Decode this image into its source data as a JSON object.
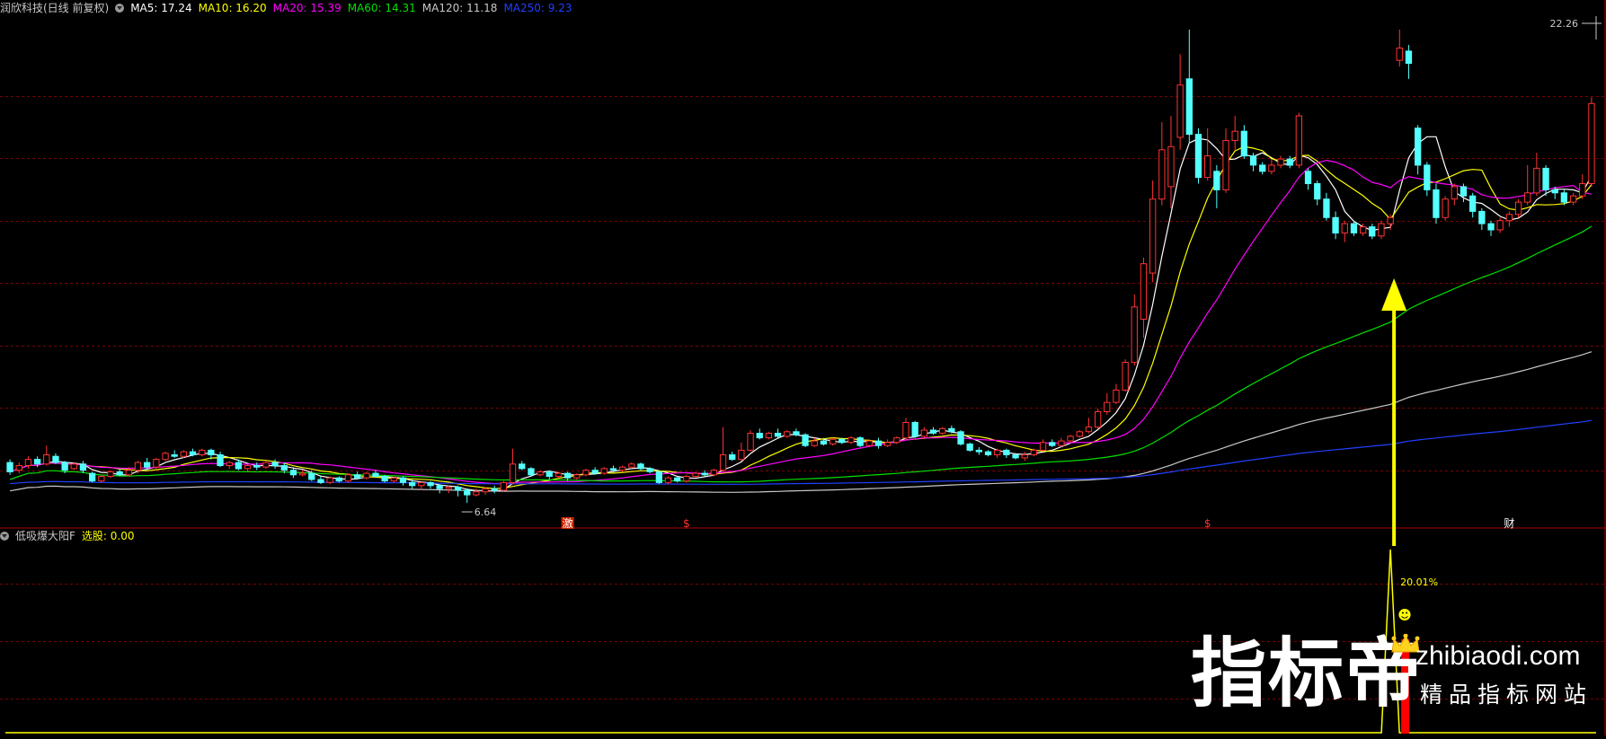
{
  "main_header": {
    "title": "润欣科技(日线 前复权)",
    "ma": [
      {
        "label": "MA5: 17.24",
        "color": "#ffffff"
      },
      {
        "label": "MA10: 16.20",
        "color": "#ffff00"
      },
      {
        "label": "MA20: 15.39",
        "color": "#ff00ff"
      },
      {
        "label": "MA60: 14.31",
        "color": "#00e000"
      },
      {
        "label": "MA120: 11.18",
        "color": "#c8c8c8"
      },
      {
        "label": "MA250: 9.23",
        "color": "#2040ff"
      }
    ]
  },
  "sub_header": {
    "indicator": "低吸爆大阳F",
    "select_label": "选股: 0.00"
  },
  "price_high_label": "22.26",
  "price_low_label": "6.64",
  "event_markers": [
    {
      "text": "激",
      "color": "#ffffff",
      "bg": "#cc2200",
      "index": 61
    },
    {
      "text": "$",
      "color": "#ff3030",
      "bg": "",
      "index": 74
    },
    {
      "text": "$",
      "color": "#ff3030",
      "bg": "",
      "index": 131
    },
    {
      "text": "财",
      "color": "#ffffff",
      "bg": "",
      "index": 164
    }
  ],
  "signal_label": "20.01%",
  "signal_emoji": "☻",
  "logo": {
    "big": "指标帝",
    "domain": "zhibiaodi.com",
    "slogan": "精品指标网站"
  },
  "colors": {
    "up": "#ff3232",
    "down": "#54ffff",
    "arrow": "#ffff00",
    "grid": "#7a0000"
  },
  "chart_data": [
    {
      "type": "candlestick",
      "title": "润欣科技(日线 前复权)",
      "ylim": [
        6.0,
        22.26
      ],
      "axis_labels": [
        "22.26"
      ],
      "candles": [
        [
          7.95,
          7.65,
          8.05,
          7.55
        ],
        [
          7.7,
          7.85,
          7.95,
          7.6
        ],
        [
          7.85,
          8.05,
          8.15,
          7.75
        ],
        [
          8.05,
          7.9,
          8.15,
          7.8
        ],
        [
          7.9,
          8.2,
          8.5,
          7.85
        ],
        [
          8.15,
          7.95,
          8.25,
          7.9
        ],
        [
          7.95,
          7.7,
          8.0,
          7.6
        ],
        [
          7.75,
          7.9,
          7.95,
          7.7
        ],
        [
          7.9,
          7.7,
          8.0,
          7.6
        ],
        [
          7.6,
          7.35,
          7.65,
          7.3
        ],
        [
          7.35,
          7.5,
          7.55,
          7.3
        ],
        [
          7.5,
          7.65,
          7.7,
          7.45
        ],
        [
          7.65,
          7.55,
          7.75,
          7.5
        ],
        [
          7.55,
          7.7,
          7.8,
          7.5
        ],
        [
          7.7,
          7.95,
          8.0,
          7.6
        ],
        [
          7.95,
          7.8,
          8.1,
          7.7
        ],
        [
          7.8,
          8.05,
          8.1,
          7.75
        ],
        [
          8.05,
          8.25,
          8.3,
          8.0
        ],
        [
          8.2,
          8.15,
          8.35,
          8.1
        ],
        [
          8.15,
          8.3,
          8.35,
          8.1
        ],
        [
          8.3,
          8.2,
          8.4,
          8.15
        ],
        [
          8.2,
          8.35,
          8.4,
          8.15
        ],
        [
          8.35,
          8.2,
          8.4,
          8.05
        ],
        [
          8.2,
          7.85,
          8.3,
          7.8
        ],
        [
          7.85,
          7.95,
          8.0,
          7.75
        ],
        [
          7.95,
          7.75,
          8.05,
          7.7
        ],
        [
          7.75,
          7.85,
          7.9,
          7.65
        ],
        [
          7.85,
          7.8,
          7.95,
          7.7
        ],
        [
          7.8,
          7.95,
          8.0,
          7.75
        ],
        [
          7.95,
          7.85,
          8.05,
          7.75
        ],
        [
          7.85,
          7.7,
          7.95,
          7.6
        ],
        [
          7.7,
          7.55,
          7.8,
          7.45
        ],
        [
          7.55,
          7.6,
          7.7,
          7.5
        ],
        [
          7.6,
          7.4,
          7.7,
          7.35
        ],
        [
          7.4,
          7.3,
          7.5,
          7.25
        ],
        [
          7.3,
          7.45,
          7.5,
          7.25
        ],
        [
          7.45,
          7.35,
          7.5,
          7.3
        ],
        [
          7.35,
          7.55,
          7.6,
          7.3
        ],
        [
          7.55,
          7.45,
          7.65,
          7.4
        ],
        [
          7.45,
          7.6,
          7.65,
          7.4
        ],
        [
          7.6,
          7.5,
          7.7,
          7.45
        ],
        [
          7.5,
          7.35,
          7.55,
          7.3
        ],
        [
          7.35,
          7.45,
          7.5,
          7.3
        ],
        [
          7.45,
          7.3,
          7.5,
          7.2
        ],
        [
          7.3,
          7.2,
          7.4,
          7.1
        ],
        [
          7.2,
          7.3,
          7.35,
          7.05
        ],
        [
          7.3,
          7.2,
          7.35,
          7.1
        ],
        [
          7.2,
          7.1,
          7.25,
          6.95
        ],
        [
          7.1,
          7.15,
          7.2,
          6.95
        ],
        [
          7.15,
          7.05,
          7.2,
          6.85
        ],
        [
          7.05,
          6.9,
          7.1,
          6.64
        ],
        [
          6.9,
          7.0,
          7.1,
          6.85
        ],
        [
          7.0,
          7.1,
          7.15,
          6.9
        ],
        [
          7.1,
          7.05,
          7.2,
          6.95
        ],
        [
          7.05,
          7.3,
          7.35,
          7.0
        ],
        [
          7.3,
          7.9,
          8.4,
          7.25
        ],
        [
          7.9,
          7.75,
          8.0,
          7.7
        ],
        [
          7.75,
          7.55,
          7.8,
          7.5
        ],
        [
          7.55,
          7.65,
          7.7,
          7.5
        ],
        [
          7.65,
          7.5,
          7.7,
          7.4
        ],
        [
          7.5,
          7.6,
          7.65,
          7.45
        ],
        [
          7.6,
          7.45,
          7.65,
          7.35
        ],
        [
          7.45,
          7.55,
          7.6,
          7.4
        ],
        [
          7.55,
          7.7,
          7.75,
          7.5
        ],
        [
          7.7,
          7.6,
          7.8,
          7.55
        ],
        [
          7.6,
          7.75,
          7.8,
          7.55
        ],
        [
          7.75,
          7.7,
          7.85,
          7.6
        ],
        [
          7.7,
          7.8,
          7.85,
          7.65
        ],
        [
          7.8,
          7.9,
          7.95,
          7.75
        ],
        [
          7.9,
          7.75,
          7.95,
          7.7
        ],
        [
          7.75,
          7.65,
          7.8,
          7.6
        ],
        [
          7.65,
          7.3,
          7.7,
          7.25
        ],
        [
          7.3,
          7.45,
          7.5,
          7.25
        ],
        [
          7.45,
          7.35,
          7.5,
          7.3
        ],
        [
          7.35,
          7.5,
          7.55,
          7.3
        ],
        [
          7.5,
          7.6,
          7.65,
          7.45
        ],
        [
          7.6,
          7.55,
          7.7,
          7.5
        ],
        [
          7.55,
          7.7,
          7.75,
          7.5
        ],
        [
          7.7,
          8.2,
          9.1,
          7.65
        ],
        [
          8.2,
          8.05,
          8.3,
          8.0
        ],
        [
          8.05,
          8.35,
          8.6,
          8.0
        ],
        [
          8.35,
          8.9,
          9.0,
          8.3
        ],
        [
          8.9,
          8.75,
          9.05,
          8.7
        ],
        [
          8.75,
          8.9,
          8.95,
          8.7
        ],
        [
          8.9,
          8.8,
          9.05,
          8.75
        ],
        [
          8.8,
          8.95,
          9.0,
          8.75
        ],
        [
          8.95,
          8.85,
          9.05,
          8.8
        ],
        [
          8.85,
          8.5,
          8.9,
          8.45
        ],
        [
          8.5,
          8.65,
          8.75,
          8.45
        ],
        [
          8.65,
          8.55,
          8.75,
          8.5
        ],
        [
          8.55,
          8.7,
          8.75,
          8.5
        ],
        [
          8.7,
          8.6,
          8.75,
          8.55
        ],
        [
          8.6,
          8.75,
          8.8,
          8.55
        ],
        [
          8.75,
          8.5,
          8.8,
          8.45
        ],
        [
          8.5,
          8.65,
          8.7,
          8.45
        ],
        [
          8.65,
          8.5,
          8.75,
          8.4
        ],
        [
          8.5,
          8.6,
          8.7,
          8.45
        ],
        [
          8.6,
          8.75,
          8.8,
          8.55
        ],
        [
          8.75,
          9.25,
          9.4,
          8.7
        ],
        [
          9.25,
          8.8,
          9.3,
          8.75
        ],
        [
          8.8,
          9.0,
          9.1,
          8.75
        ],
        [
          9.0,
          8.9,
          9.1,
          8.85
        ],
        [
          8.9,
          9.05,
          9.1,
          8.85
        ],
        [
          9.05,
          8.95,
          9.15,
          8.9
        ],
        [
          8.95,
          8.55,
          9.0,
          8.5
        ],
        [
          8.55,
          8.35,
          8.6,
          8.3
        ],
        [
          8.35,
          8.3,
          8.45,
          8.2
        ],
        [
          8.3,
          8.2,
          8.35,
          8.15
        ],
        [
          8.2,
          8.35,
          8.4,
          8.1
        ],
        [
          8.35,
          8.2,
          8.4,
          8.1
        ],
        [
          8.2,
          8.1,
          8.25,
          8.05
        ],
        [
          8.1,
          8.2,
          8.3,
          8.0
        ],
        [
          8.2,
          8.35,
          8.4,
          8.15
        ],
        [
          8.35,
          8.6,
          8.7,
          8.3
        ],
        [
          8.6,
          8.5,
          8.7,
          8.45
        ],
        [
          8.5,
          8.65,
          8.75,
          8.45
        ],
        [
          8.65,
          8.8,
          8.85,
          8.6
        ],
        [
          8.8,
          8.95,
          9.0,
          8.75
        ],
        [
          8.95,
          9.1,
          9.4,
          8.9
        ],
        [
          9.1,
          9.6,
          9.7,
          9.05
        ],
        [
          9.6,
          9.9,
          10.2,
          9.5
        ],
        [
          9.9,
          10.3,
          10.5,
          9.85
        ],
        [
          10.3,
          11.2,
          11.3,
          10.25
        ],
        [
          11.2,
          13.0,
          13.4,
          11.1
        ],
        [
          12.6,
          14.4,
          14.6,
          12.0
        ],
        [
          14.1,
          16.5,
          17.1,
          13.8
        ],
        [
          16.5,
          18.1,
          19.0,
          16.3
        ],
        [
          16.9,
          18.2,
          19.2,
          16.2
        ],
        [
          18.5,
          20.2,
          21.2,
          18.1
        ],
        [
          20.4,
          18.6,
          22.0,
          18.3
        ],
        [
          18.6,
          17.2,
          18.8,
          17.0
        ],
        [
          17.2,
          17.9,
          18.8,
          17.1
        ],
        [
          17.4,
          16.8,
          17.6,
          16.2
        ],
        [
          16.8,
          18.4,
          18.8,
          16.7
        ],
        [
          18.4,
          18.7,
          19.2,
          18.1
        ],
        [
          18.7,
          17.9,
          18.9,
          17.8
        ],
        [
          17.9,
          17.6,
          18.0,
          17.4
        ],
        [
          17.6,
          17.4,
          17.7,
          17.3
        ],
        [
          17.4,
          17.6,
          17.8,
          17.3
        ],
        [
          17.6,
          17.8,
          17.9,
          17.5
        ],
        [
          17.8,
          17.6,
          17.9,
          17.5
        ],
        [
          17.6,
          19.2,
          19.3,
          17.5
        ],
        [
          17.4,
          17.0,
          17.5,
          16.8
        ],
        [
          17.0,
          16.5,
          17.1,
          16.3
        ],
        [
          16.5,
          15.9,
          16.7,
          15.8
        ],
        [
          15.9,
          15.4,
          16.1,
          15.2
        ],
        [
          15.4,
          15.7,
          15.8,
          15.1
        ],
        [
          15.7,
          15.4,
          15.8,
          15.3
        ],
        [
          15.4,
          15.6,
          15.7,
          15.3
        ],
        [
          15.6,
          15.3,
          15.7,
          15.2
        ],
        [
          15.3,
          15.7,
          15.8,
          15.2
        ],
        [
          15.7,
          15.9,
          16.0,
          15.5
        ],
        [
          21.0,
          21.4,
          22.0,
          20.8
        ],
        [
          21.3,
          20.9,
          21.5,
          20.4
        ],
        [
          18.8,
          17.6,
          18.9,
          17.3
        ],
        [
          17.6,
          16.8,
          17.7,
          16.6
        ],
        [
          16.8,
          15.9,
          17.0,
          15.7
        ],
        [
          15.9,
          16.5,
          16.6,
          15.8
        ],
        [
          16.5,
          16.9,
          17.0,
          16.3
        ],
        [
          16.9,
          16.6,
          17.0,
          16.4
        ],
        [
          16.6,
          16.1,
          16.7,
          15.9
        ],
        [
          16.1,
          15.7,
          16.2,
          15.5
        ],
        [
          15.7,
          15.5,
          15.8,
          15.3
        ],
        [
          15.5,
          15.8,
          15.9,
          15.4
        ],
        [
          15.8,
          16.0,
          16.1,
          15.6
        ],
        [
          16.0,
          16.4,
          16.5,
          15.9
        ],
        [
          16.4,
          16.7,
          17.6,
          16.3
        ],
        [
          16.7,
          17.5,
          18.0,
          16.6
        ],
        [
          17.5,
          16.8,
          17.6,
          16.6
        ],
        [
          16.8,
          16.7,
          16.9,
          16.5
        ],
        [
          16.7,
          16.4,
          16.8,
          16.3
        ],
        [
          16.4,
          16.6,
          16.7,
          16.3
        ],
        [
          16.6,
          17.0,
          17.3,
          16.5
        ],
        [
          17.0,
          19.6,
          19.8,
          16.9
        ]
      ],
      "ma_series": [
        {
          "name": "MA5",
          "color": "#ffffff",
          "period": 5
        },
        {
          "name": "MA10",
          "color": "#ffff00",
          "period": 10
        },
        {
          "name": "MA20",
          "color": "#ff00ff",
          "period": 20
        },
        {
          "name": "MA60",
          "color": "#00e000",
          "period": 60
        },
        {
          "name": "MA120",
          "color": "#c8c8c8",
          "period": 120
        },
        {
          "name": "MA250",
          "color": "#2040ff",
          "period": 250
        }
      ],
      "grid": true
    },
    {
      "type": "line",
      "title": "低吸爆大阳F",
      "series": [
        {
          "name": "选股",
          "values": "0 on all days except a spike to 1 on day 151"
        }
      ],
      "signal_index": 151,
      "ylim": [
        0,
        1
      ]
    }
  ]
}
